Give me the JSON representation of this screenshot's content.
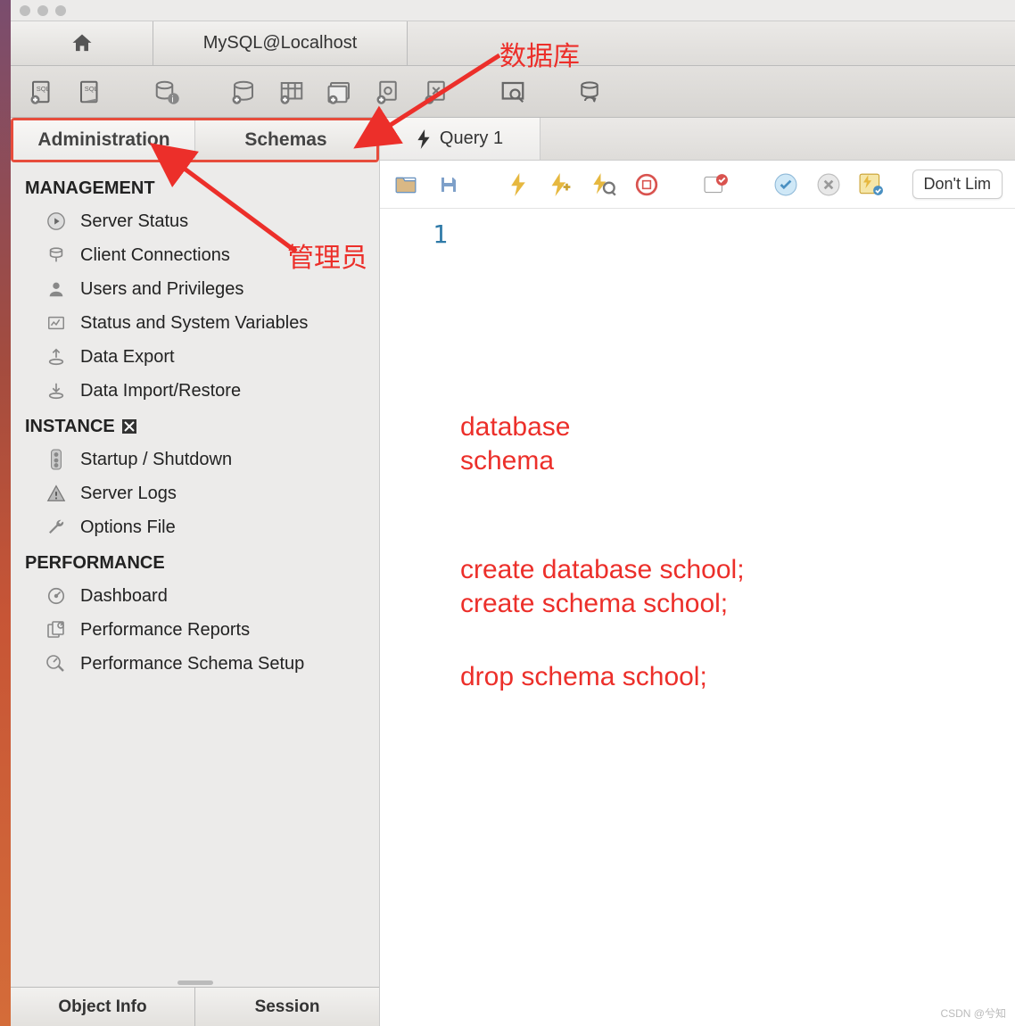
{
  "tabs": {
    "connection": "MySQL@Localhost"
  },
  "sidebar": {
    "panel_tabs": {
      "admin": "Administration",
      "schemas": "Schemas"
    },
    "groups": {
      "management": {
        "label": "MANAGEMENT",
        "items": [
          "Server Status",
          "Client Connections",
          "Users and Privileges",
          "Status and System Variables",
          "Data Export",
          "Data Import/Restore"
        ]
      },
      "instance": {
        "label": "INSTANCE",
        "items": [
          "Startup / Shutdown",
          "Server Logs",
          "Options File"
        ]
      },
      "performance": {
        "label": "PERFORMANCE",
        "items": [
          "Dashboard",
          "Performance Reports",
          "Performance Schema Setup"
        ]
      }
    },
    "bottom_tabs": {
      "info": "Object Info",
      "session": "Session"
    }
  },
  "editor": {
    "tab_label": "Query 1",
    "limit_label": "Don't Lim",
    "line_number": "1"
  },
  "annotations": {
    "db_label": "数据库",
    "admin_label": "管理员",
    "note1a": "database",
    "note1b": "schema",
    "note2a": "create database school;",
    "note2b": "create schema school;",
    "note3": "drop schema school;",
    "watermark": "CSDN @兮知"
  }
}
